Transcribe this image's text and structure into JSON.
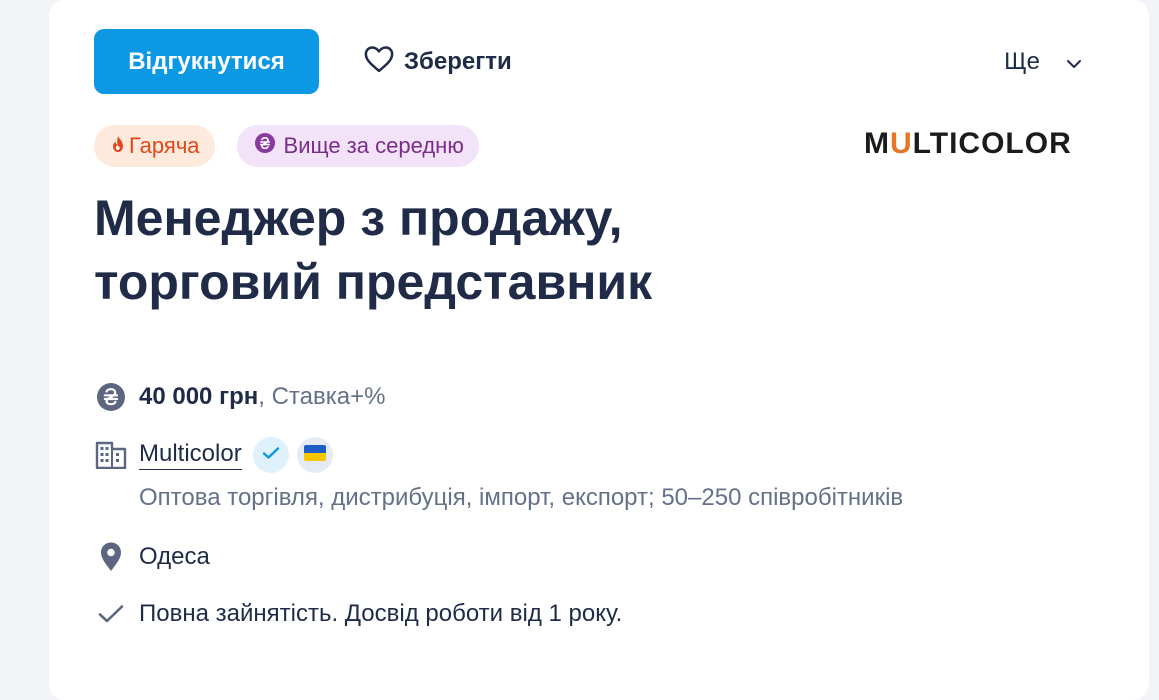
{
  "actions": {
    "apply_label": "Відгукнутися",
    "save_label": "Зберегти",
    "more_label": "Ще"
  },
  "badges": {
    "hot_label": "Гаряча",
    "salary_label": "Вище за середню"
  },
  "company_logo": {
    "text_prefix": "M",
    "text_accent": "U",
    "text_suffix": "LTICOLOR",
    "accent_color": "#e87524"
  },
  "vacancy": {
    "title_line1": "Менеджер з продажу,",
    "title_line2": "торговий представник"
  },
  "details": {
    "salary_amount": "40 000 грн",
    "salary_note": ", Ставка+%",
    "company_name": "Multicolor",
    "company_info": "Оптова торгівля, дистрибуція, імпорт, експорт; 50–250 співробітників",
    "city": "Одеса",
    "conditions": "Повна зайнятість. Досвід роботи від 1 року."
  },
  "icons": {
    "save": "heart-icon",
    "more": "chevron-down-icon",
    "hot": "flame-icon",
    "salary_badge": "hryvnia-icon",
    "salary_row": "hryvnia-coin-icon",
    "company": "building-icon",
    "verified": "check-icon",
    "flag": "ukraine-flag-icon",
    "city": "location-pin-icon",
    "conditions": "checkmark-icon"
  },
  "colors": {
    "primary": "#0d98e3",
    "text": "#1f2b47",
    "muted": "#65708a",
    "hot_bg": "#feeadd",
    "hot_text": "#e0481c",
    "salary_bg": "#f3e3f8",
    "salary_text": "#7a2d8b"
  }
}
